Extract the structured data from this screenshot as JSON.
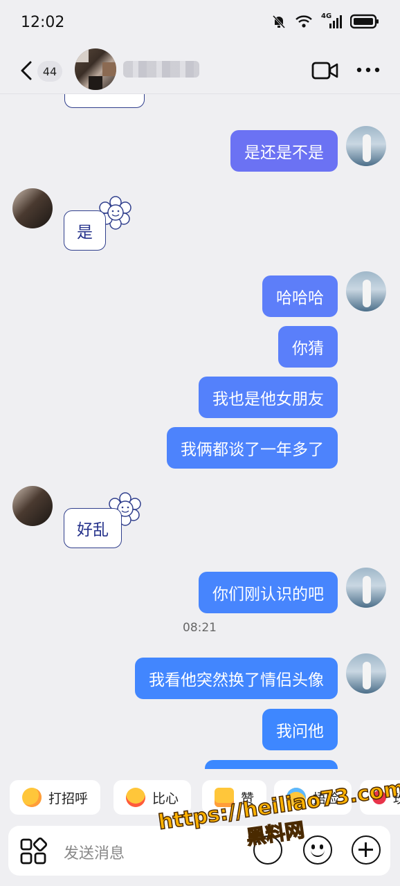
{
  "status_bar": {
    "time": "12:02",
    "network": "4G"
  },
  "header": {
    "unread_count": "44"
  },
  "messages": [
    {
      "text": "是还是不是"
    },
    {
      "text": "是"
    },
    {
      "text": "哈哈哈"
    },
    {
      "text": "你猜"
    },
    {
      "text": "我也是他女朋友"
    },
    {
      "text": "我俩都谈了一年多了"
    },
    {
      "text": "好乱"
    },
    {
      "text": "你们刚认识的吧"
    },
    {
      "text": "我看他突然换了情侣头像"
    },
    {
      "text": "我问他"
    }
  ],
  "timestamp": "08:21",
  "quick_replies": [
    {
      "label": "打招呼",
      "icon": "smile-face-icon"
    },
    {
      "label": "比心",
      "icon": "finger-heart-icon"
    },
    {
      "label": "赞",
      "icon": "thumbs-up-icon"
    },
    {
      "label": "捂脸",
      "icon": "facepalm-icon"
    },
    {
      "label": "玫",
      "icon": "rose-icon"
    }
  ],
  "input": {
    "placeholder": "发送消息"
  },
  "watermark": {
    "line1": "https://heiliao73.com",
    "line2": "黑料网"
  },
  "colors": {
    "bubble_purple": "#6b72f3",
    "bubble_blue": "#3d82ff",
    "other_border": "#2f3e8c",
    "background": "#efeff2"
  }
}
